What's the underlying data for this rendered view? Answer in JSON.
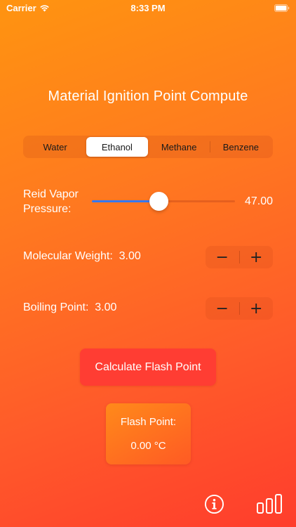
{
  "status_bar": {
    "carrier": "Carrier",
    "time": "8:33 PM"
  },
  "title": "Material Ignition Point Compute",
  "segments": {
    "selected": "Ethanol",
    "items": [
      {
        "label": "Water"
      },
      {
        "label": "Ethanol"
      },
      {
        "label": "Methane"
      },
      {
        "label": "Benzene"
      }
    ]
  },
  "reid_vapor_pressure": {
    "label": "Reid Vapor Pressure:",
    "value_text": "47.00",
    "slider_fraction": 0.47
  },
  "molecular_weight": {
    "label": "Molecular Weight:",
    "value": "3.00",
    "minus": "−",
    "plus": "+"
  },
  "boiling_point": {
    "label": "Boiling Point:",
    "value": "3.00",
    "minus": "−",
    "plus": "+"
  },
  "calculate_button": {
    "label": "Calculate Flash Point"
  },
  "result": {
    "label": "Flash Point:",
    "value": "0.00 °C"
  },
  "icons": {
    "info": "info-icon",
    "chart": "bar-chart-icon"
  },
  "colors": {
    "slider_fill": "#3478f6",
    "button": "#ff3d33"
  }
}
